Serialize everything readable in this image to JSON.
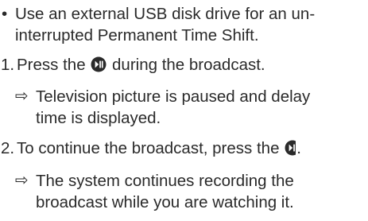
{
  "bullet_item": {
    "marker": "•",
    "line1": "Use an external USB disk drive for an un-",
    "line2": "interrupted Permanent Time Shift."
  },
  "steps": [
    {
      "number": "1.",
      "text_before_icon": "Press the",
      "icon": "play-pause-button-icon",
      "text_after_icon": "during the broadcast.",
      "result": {
        "marker": "⇨",
        "line1": "Television picture is paused and delay",
        "line2": "time is displayed."
      }
    },
    {
      "number": "2.",
      "text_before_icon": "To continue the broadcast, press the",
      "icon": "play-pause-button-icon",
      "text_after_icon": ".",
      "result": {
        "marker": "⇨",
        "line1": "The system continues recording the",
        "line2": "broadcast while you are watching it."
      }
    }
  ],
  "colors": {
    "text": "#2a2a2a",
    "icon_fill": "#2a2a2a",
    "icon_glyph": "#ffffff"
  }
}
